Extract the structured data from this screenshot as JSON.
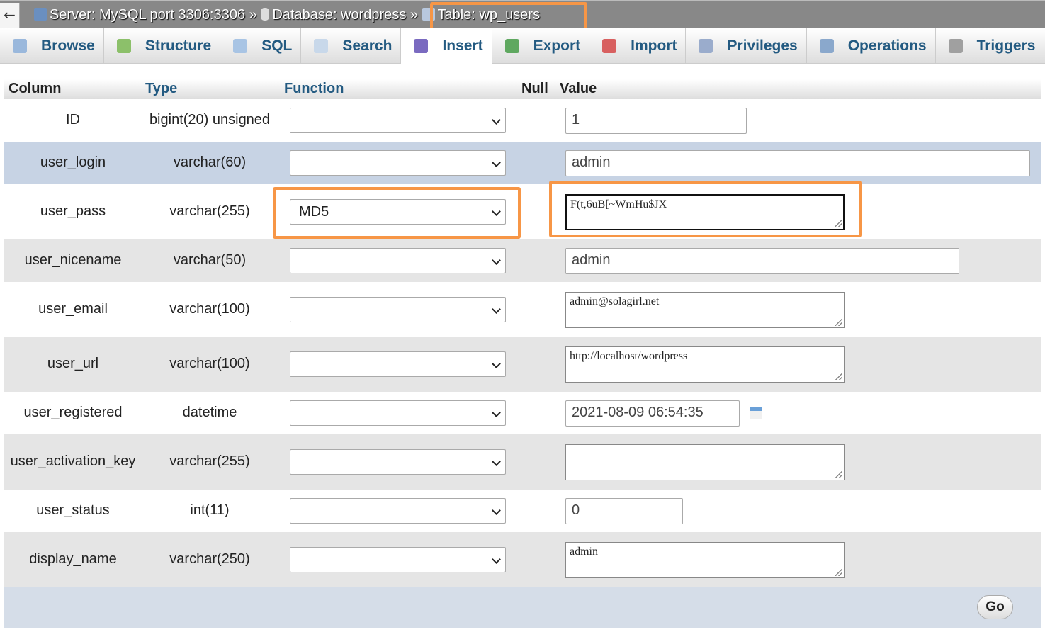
{
  "breadcrumb": {
    "server": "Server: MySQL port 3306:3306",
    "sep": "»",
    "database": "Database: wordpress",
    "table": "Table: wp_users"
  },
  "tabs": [
    {
      "label": "Browse",
      "icon": "browse-icon"
    },
    {
      "label": "Structure",
      "icon": "structure-icon"
    },
    {
      "label": "SQL",
      "icon": "sql-icon"
    },
    {
      "label": "Search",
      "icon": "search-icon"
    },
    {
      "label": "Insert",
      "icon": "insert-icon",
      "active": true
    },
    {
      "label": "Export",
      "icon": "export-icon"
    },
    {
      "label": "Import",
      "icon": "import-icon"
    },
    {
      "label": "Privileges",
      "icon": "privileges-icon"
    },
    {
      "label": "Operations",
      "icon": "wrench-icon"
    },
    {
      "label": "Triggers",
      "icon": "triggers-icon"
    }
  ],
  "headers": {
    "column": "Column",
    "type": "Type",
    "function": "Function",
    "null": "Null",
    "value": "Value"
  },
  "rows": [
    {
      "column": "ID",
      "type": "bigint(20) unsigned",
      "function": "",
      "value": "1"
    },
    {
      "column": "user_login",
      "type": "varchar(60)",
      "function": "",
      "value": "admin"
    },
    {
      "column": "user_pass",
      "type": "varchar(255)",
      "function": "MD5",
      "value": "F(t,6uB[~WmHu$JX"
    },
    {
      "column": "user_nicename",
      "type": "varchar(50)",
      "function": "",
      "value": "admin"
    },
    {
      "column": "user_email",
      "type": "varchar(100)",
      "function": "",
      "value": "admin@solagirl.net"
    },
    {
      "column": "user_url",
      "type": "varchar(100)",
      "function": "",
      "value": "http://localhost/wordpress"
    },
    {
      "column": "user_registered",
      "type": "datetime",
      "function": "",
      "value": "2021-08-09 06:54:35"
    },
    {
      "column": "user_activation_key",
      "type": "varchar(255)",
      "function": "",
      "value": ""
    },
    {
      "column": "user_status",
      "type": "int(11)",
      "function": "",
      "value": "0"
    },
    {
      "column": "display_name",
      "type": "varchar(250)",
      "function": "",
      "value": "admin"
    }
  ],
  "go_label": "Go",
  "colors": {
    "accent": "#235a81",
    "highlight": "#f79646",
    "row_alt": "#e5e5e5",
    "row_selected": "#c7d3e4"
  }
}
